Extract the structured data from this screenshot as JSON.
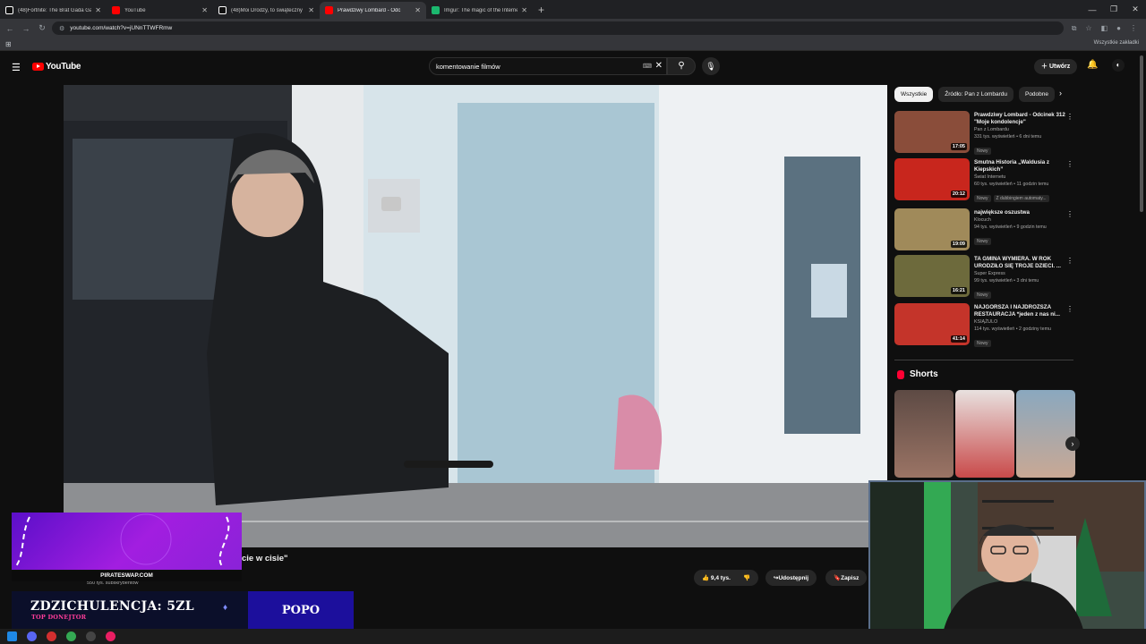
{
  "browser": {
    "tabs": [
      {
        "title": "(48)Fortnite: The Brat Gada Gaa",
        "icon": "tiktok-icon",
        "color": "#ffffff"
      },
      {
        "title": "YouTube",
        "icon": "youtube-icon",
        "color": "#ff0000"
      },
      {
        "title": "(48)Moi Drodzy, to świąteczny",
        "icon": "tiktok-icon",
        "color": "#ffffff"
      },
      {
        "title": "Prawdziwy Lombard - Odc",
        "icon": "youtube-icon",
        "color": "#ff0000"
      },
      {
        "title": "Imgur: The magic of the Interne",
        "icon": "imgur-icon",
        "color": "#1bb76e"
      }
    ],
    "url": "youtube.com/watch?v=jUNnTTWFRmw",
    "bookmarks_all": "Wszystkie zakładki"
  },
  "youtube": {
    "logo_text": "YouTube",
    "search_value": "komentowanie filmów",
    "create_label": "Utwórz",
    "video_title_partial": "cie w cisie\"",
    "subscribers_partial": "550 tys. subskrybentów",
    "actions": {
      "likes": "9,4 tys.",
      "share": "Udostępnij",
      "save": "Zapisz"
    },
    "chips": [
      "Wszystkie",
      "Źródło: Pan z Lombardu",
      "Podobne"
    ],
    "recommendations": [
      {
        "title": "Prawdziwy Lombard - Odcinek 312 \"Moje kondolencje\"",
        "channel": "Pan z Lombardu",
        "meta": "331 tys. wyświetleń • 6 dni temu",
        "badge": "Nowy",
        "duration": "17:05",
        "thumb_color": "#8a4d3a"
      },
      {
        "title": "Smutna Historia „Waldusia z Kiepskich”",
        "channel": "Świat Internetu",
        "meta": "60 tys. wyświetleń • 11 godzin temu",
        "badge": "Nowy",
        "badge2": "Z dubbingiem automaty...",
        "duration": "20:12",
        "thumb_color": "#c8261d"
      },
      {
        "title": "największe oszustwa",
        "channel": "Klocuch",
        "meta": "94 tys. wyświetleń • 9 godzin temu",
        "badge": "Nowy",
        "duration": "19:09",
        "thumb_color": "#a08a5a"
      },
      {
        "title": "TA GMINA WYMIERA. W ROK URODZIŁO SIĘ TROJE DZIECI. ...",
        "channel": "Super Express",
        "meta": "99 tys. wyświetleń • 3 dni temu",
        "badge": "Nowy",
        "duration": "16:21",
        "thumb_color": "#6d6a3c"
      },
      {
        "title": "NAJGORSZA I NAJDROŻSZA RESTAURACJA *jeden z nas ni...",
        "channel": "KSIĄŻULO",
        "meta": "114 tys. wyświetleń • 2 godziny temu",
        "badge": "Nowy",
        "duration": "41:14",
        "thumb_color": "#c4342a"
      }
    ],
    "shorts_heading": "Shorts",
    "shorts": [
      {
        "color": "#7a5c4e"
      },
      {
        "color": "#c94a4a"
      },
      {
        "color": "#6f8aa0"
      }
    ]
  },
  "overlay": {
    "pirate_banner": "PIRATESWAP.COM",
    "donation_text": "ZDZICHULENCJA: 5ZL",
    "donation_sub": "TOP DONEJTOR",
    "donor_name": "POPO"
  }
}
